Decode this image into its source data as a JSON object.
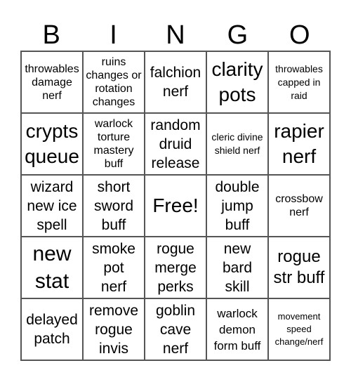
{
  "header": {
    "letters": [
      "B",
      "I",
      "N",
      "G",
      "O"
    ]
  },
  "board": {
    "cells": [
      "throwables damage nerf",
      "ruins changes or rotation changes",
      "falchion nerf",
      "clarity pots",
      "throwables capped in raid",
      "crypts queue",
      "warlock torture mastery buff",
      "random druid release",
      "cleric divine shield nerf",
      "rapier nerf",
      "wizard new ice spell",
      "short sword buff",
      "Free!",
      "double jump buff",
      "crossbow nerf",
      "new stat",
      "smoke pot nerf",
      "rogue merge perks",
      "new bard skill",
      "rogue str buff",
      "delayed patch",
      "remove rogue invis",
      "goblin cave nerf",
      "warlock demon form buff",
      "movement speed change/nerf"
    ]
  }
}
